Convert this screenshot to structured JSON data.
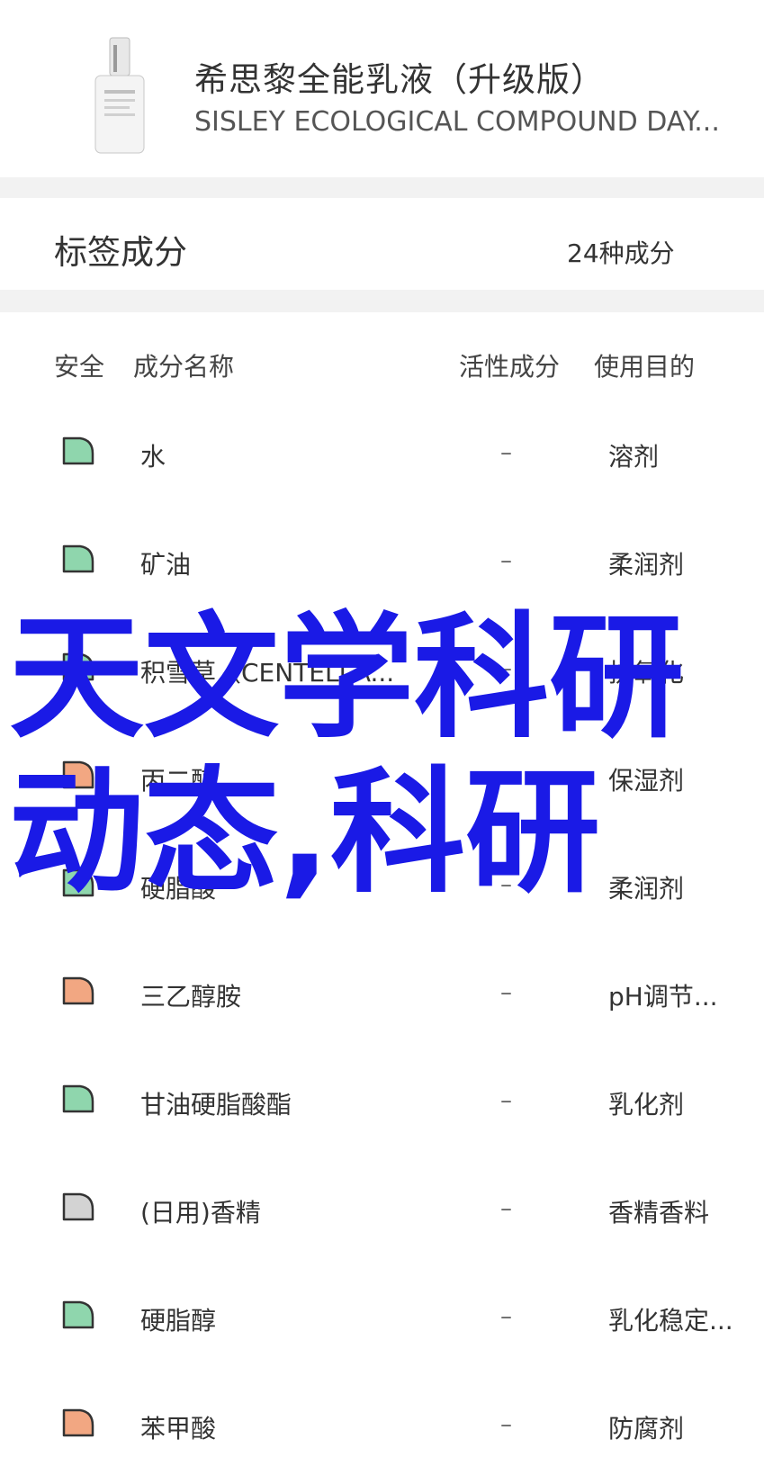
{
  "product": {
    "name_cn": "希思黎全能乳液（升级版）",
    "name_en": "SISLEY ECOLOGICAL COMPOUND DAY..."
  },
  "summary": {
    "title": "标签成分",
    "count": "24种成分"
  },
  "table": {
    "headers": {
      "safety": "安全",
      "name": "成分名称",
      "active": "活性成分",
      "purpose": "使用目的"
    },
    "rows": [
      {
        "name": "水",
        "active": "–",
        "purpose": "溶剂",
        "safety_color": "#8fd6ad"
      },
      {
        "name": "矿油",
        "active": "–",
        "purpose": "柔润剂",
        "safety_color": "#8fd6ad"
      },
      {
        "name": "积雪草（CENTELLA...",
        "active": "–",
        "purpose": "抗氧化",
        "safety_color": "#8fd6ad"
      },
      {
        "name": "丙二醇",
        "active": "–",
        "purpose": "保湿剂",
        "safety_color": "#f2a782"
      },
      {
        "name": "硬脂酸",
        "active": "–",
        "purpose": "柔润剂",
        "safety_color": "#8fd6ad"
      },
      {
        "name": "三乙醇胺",
        "active": "–",
        "purpose": "pH调节...",
        "safety_color": "#f2a782"
      },
      {
        "name": "甘油硬脂酸酯",
        "active": "–",
        "purpose": "乳化剂",
        "safety_color": "#8fd6ad"
      },
      {
        "name": "(日用)香精",
        "active": "–",
        "purpose": "香精香料",
        "safety_color": "#d3d3d3"
      },
      {
        "name": "硬脂醇",
        "active": "–",
        "purpose": "乳化稳定...",
        "safety_color": "#8fd6ad"
      },
      {
        "name": "苯甲酸",
        "active": "–",
        "purpose": "防腐剂",
        "safety_color": "#f2a782"
      }
    ]
  },
  "overlay_text": "天文学科研动态,科研"
}
